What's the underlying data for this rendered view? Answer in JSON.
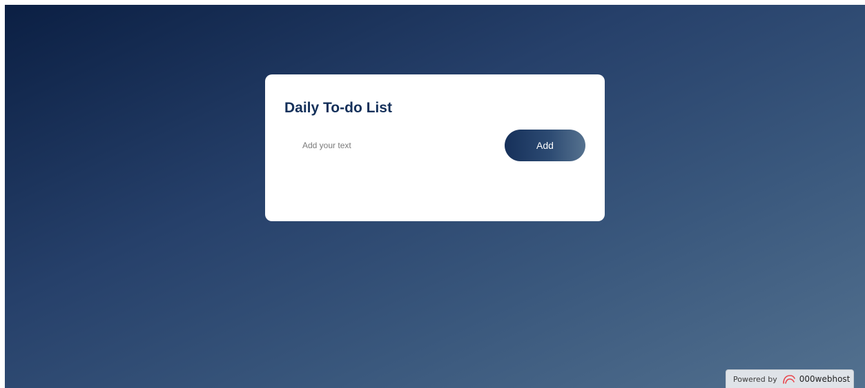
{
  "todo": {
    "title": "Daily To-do List",
    "input_placeholder": "Add your text",
    "input_value": "",
    "add_label": "Add",
    "items": []
  },
  "footer": {
    "powered_by": "Powered by",
    "brand": "000webhost",
    "logo_icon": "000webhost-logo-icon",
    "logo_color": "#e8454b"
  },
  "colors": {
    "title": "#14305a",
    "background_start": "#0b1f43",
    "background_end": "#53718f",
    "card": "#ffffff",
    "button_start": "#16305a",
    "button_end": "#56728f"
  }
}
